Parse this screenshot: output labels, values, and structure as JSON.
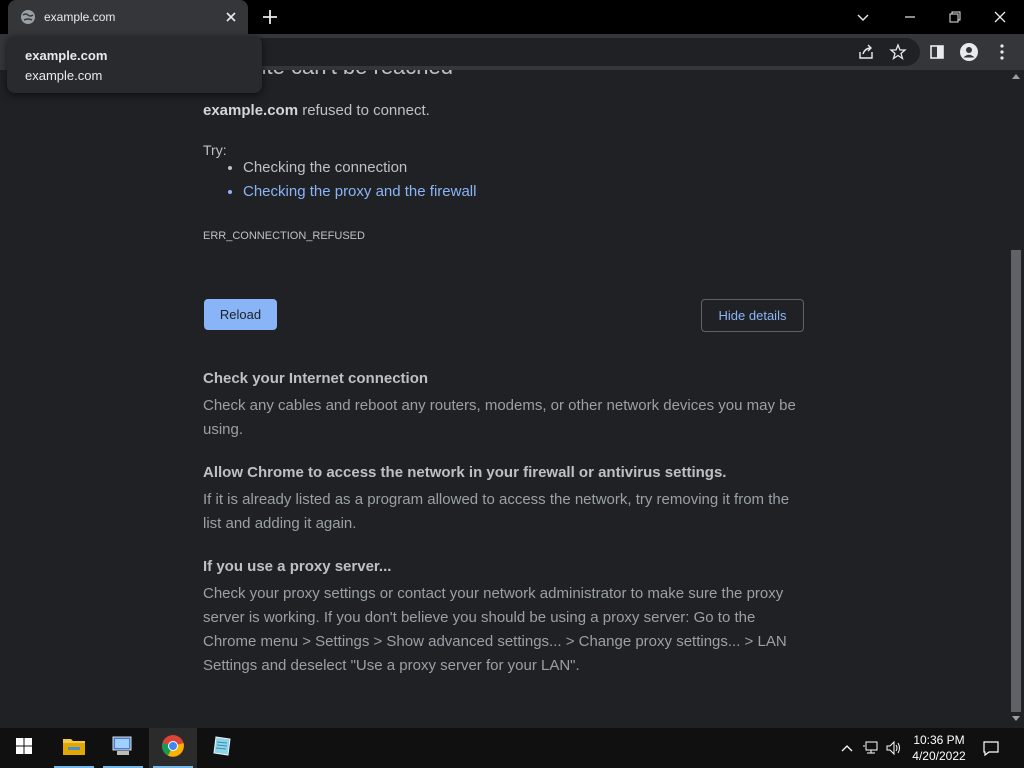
{
  "browser": {
    "tab_title": "example.com",
    "hover_card": {
      "title": "example.com",
      "url": "example.com"
    }
  },
  "page": {
    "heading": "This site can't be reached",
    "host": "example.com",
    "refused_text": " refused to connect.",
    "try_label": "Try:",
    "suggestions": [
      "Checking the connection",
      "Checking the proxy and the firewall"
    ],
    "error_code": "ERR_CONNECTION_REFUSED",
    "reload_label": "Reload",
    "hide_details_label": "Hide details",
    "sections": [
      {
        "title": "Check your Internet connection",
        "body": "Check any cables and reboot any routers, modems, or other network devices you may be using."
      },
      {
        "title": "Allow Chrome to access the network in your firewall or antivirus settings.",
        "body": "If it is already listed as a program allowed to access the network, try removing it from the list and adding it again."
      },
      {
        "title": "If you use a proxy server...",
        "body": "Check your proxy settings or contact your network administrator to make sure the proxy server is working. If you don't believe you should be using a proxy server: Go to the Chrome menu > Settings > Show advanced settings... > Change proxy settings... > LAN Settings and deselect \"Use a proxy server for your LAN\"."
      }
    ]
  },
  "taskbar": {
    "time": "10:36 PM",
    "date": "4/20/2022",
    "apps": [
      "file-explorer-icon",
      "computer-icon",
      "chrome-icon",
      "notepad-icon"
    ]
  },
  "colors": {
    "link": "#8ab4f8",
    "background": "#202124",
    "button": "#8ab4f8"
  }
}
